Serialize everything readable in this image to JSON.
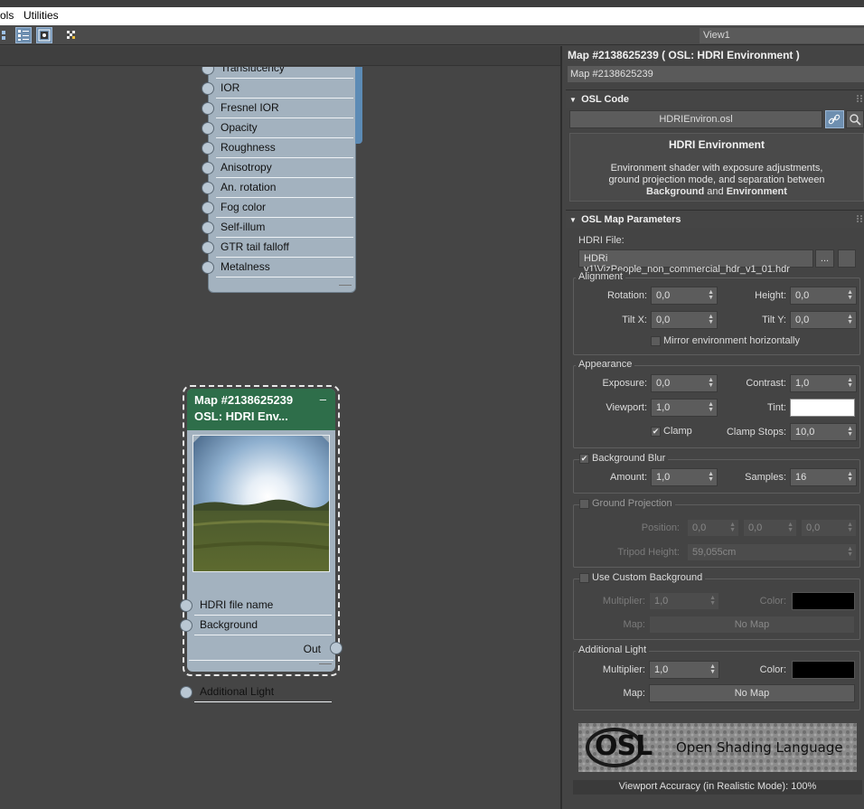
{
  "menubar": {
    "items": [
      "ols",
      "Utilities"
    ]
  },
  "viewport": {
    "label": "View1"
  },
  "node_material": {
    "slots": [
      "Translucency",
      "IOR",
      "Fresnel IOR",
      "Opacity",
      "Roughness",
      "Anisotropy",
      "An. rotation",
      "Fog color",
      "Self-illum",
      "GTR tail falloff",
      "Metalness"
    ]
  },
  "node_osl": {
    "title_line1": "Map #2138625239",
    "title_line2": "OSL: HDRI Env...",
    "minimize": "–",
    "slots": [
      "HDRI file name",
      "Background",
      "Additional Light"
    ],
    "out_label": "Out"
  },
  "panel": {
    "title": "Map #2138625239  ( OSL: HDRI Environment )",
    "name_value": "Map #2138625239",
    "osl_code": {
      "header": "OSL Code",
      "file_button": "HDRIEnviron.osl",
      "desc_title": "HDRI Environment",
      "desc_line1": "Environment shader with exposure adjustments,",
      "desc_line2": "ground projection mode, and separation between",
      "desc_bold1": "Background",
      "desc_and": " and ",
      "desc_bold2": "Environment"
    },
    "params": {
      "header": "OSL Map Parameters",
      "hdri_label": "HDRI File:",
      "hdri_value": "HDRi v1\\VizPeople_non_commercial_hdr_v1_01.hdr",
      "browse": "...",
      "alignment": {
        "label": "Alignment",
        "rotation_label": "Rotation:",
        "rotation": "0,0",
        "height_label": "Height:",
        "height": "0,0",
        "tiltx_label": "Tilt X:",
        "tiltx": "0,0",
        "tilty_label": "Tilt Y:",
        "tilty": "0,0",
        "mirror_label": "Mirror environment horizontally"
      },
      "appearance": {
        "label": "Appearance",
        "exposure_label": "Exposure:",
        "exposure": "0,0",
        "contrast_label": "Contrast:",
        "contrast": "1,0",
        "viewport_label": "Viewport:",
        "viewport": "1,0",
        "tint_label": "Tint:",
        "clamp_label": "Clamp",
        "clampstops_label": "Clamp Stops:",
        "clampstops": "10,0"
      },
      "blur": {
        "label": "Background Blur",
        "amount_label": "Amount:",
        "amount": "1,0",
        "samples_label": "Samples:",
        "samples": "16"
      },
      "ground": {
        "label": "Ground Projection",
        "position_label": "Position:",
        "pos_x": "0,0",
        "pos_y": "0,0",
        "pos_z": "0,0",
        "tripod_label": "Tripod Height:",
        "tripod": "59,055cm"
      },
      "custom_bg": {
        "label": "Use Custom Background",
        "multiplier_label": "Multiplier:",
        "multiplier": "1,0",
        "color_label": "Color:",
        "map_label": "Map:",
        "map_button": "No Map"
      },
      "additional": {
        "label": "Additional Light",
        "multiplier_label": "Multiplier:",
        "multiplier": "1,0",
        "color_label": "Color:",
        "map_label": "Map:",
        "map_button": "No Map"
      }
    },
    "banner_text": "Open Shading Language",
    "banner_logo": "OSL",
    "accuracy": "Viewport Accuracy (in Realistic Mode): 100%"
  },
  "colors": {
    "node_header": "#2e6e4a",
    "node_body": "#a3b2bf",
    "tint": "#ffffff",
    "bg_color": "#000000",
    "light_color": "#000000"
  }
}
